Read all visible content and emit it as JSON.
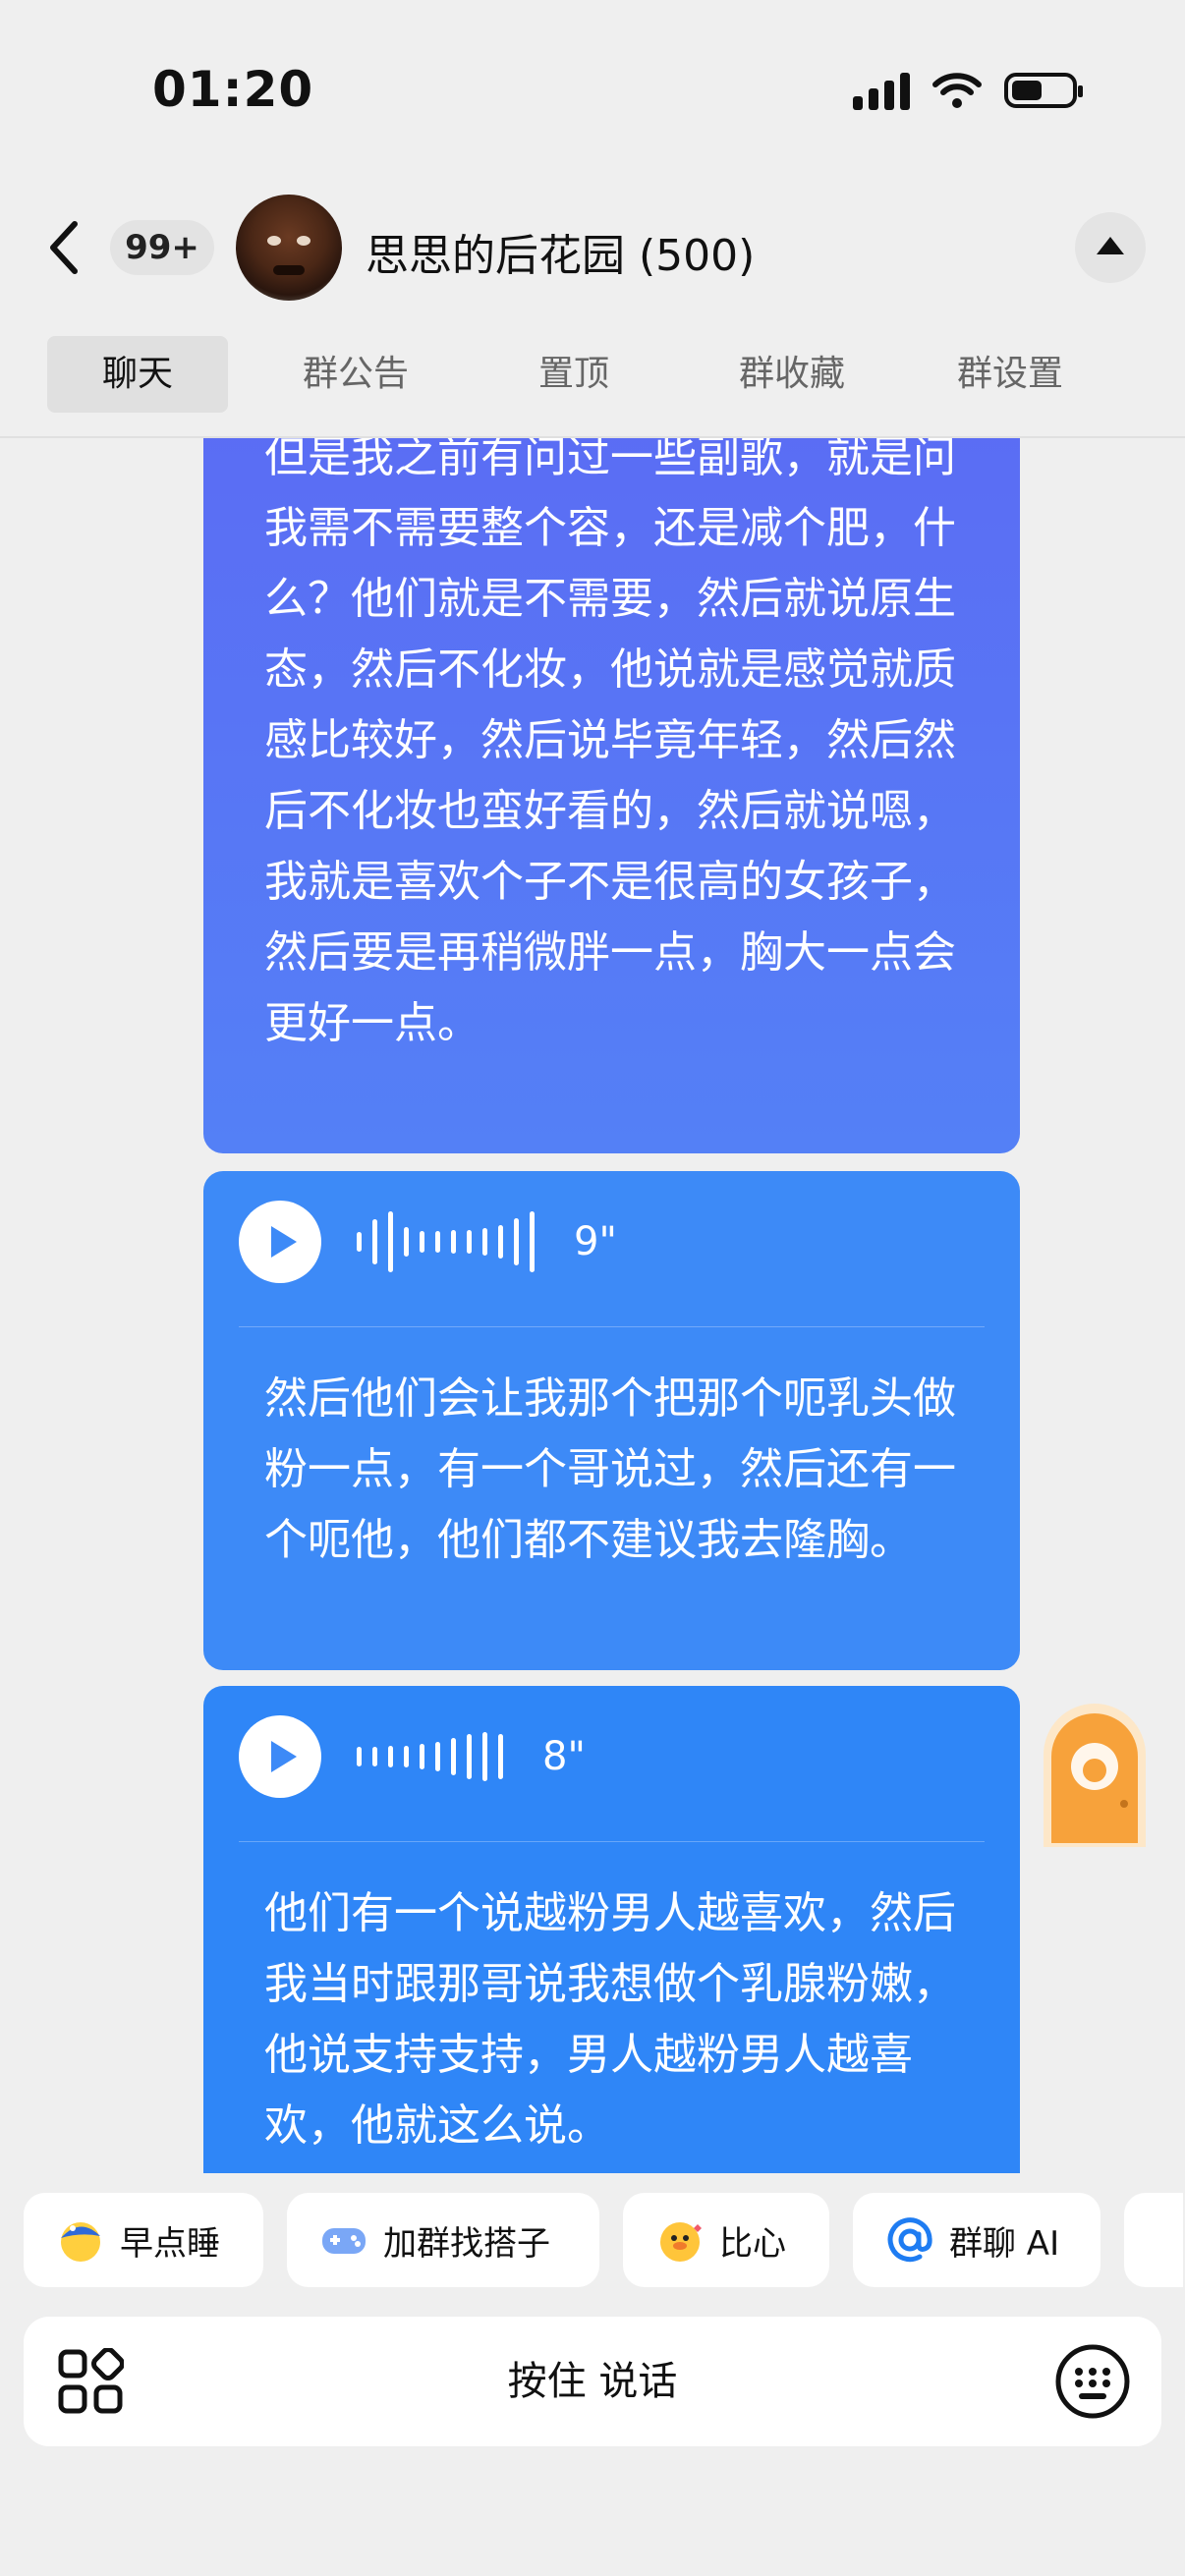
{
  "status_bar": {
    "time": "01:20"
  },
  "header": {
    "unread_count": "99+",
    "group_title": "思思的后花园 (500)"
  },
  "tabs": [
    "聊天",
    "群公告",
    "置顶",
    "群收藏",
    "群设置"
  ],
  "messages": [
    {
      "type": "text",
      "text": "但是我之前有问过一些副歌，就是问我需不需要整个容，还是减个肥，什么？他们就是不需要，然后就说原生态，然后不化妆，他说就是感觉就质感比较好，然后说毕竟年轻，然后然后不化妆也蛮好看的，然后就说嗯，我就是喜欢个子不是很高的女孩子，然后要是再稍微胖一点，胸大一点会更好一点。"
    },
    {
      "type": "voice",
      "duration": "9\"",
      "transcript": "然后他们会让我那个把那个呃乳头做粉一点，有一个哥说过，然后还有一个呃他，他们都不建议我去隆胸。"
    },
    {
      "type": "voice",
      "duration": "8\"",
      "transcript": "他们有一个说越粉男人越喜欢，然后我当时跟那哥说我想做个乳腺粉嫩，他说支持支持，男人越粉男人越喜欢，他就这么说。"
    }
  ],
  "quick_actions": [
    {
      "label": "早点睡",
      "icon": "sleep-planet-icon"
    },
    {
      "label": "加群找搭子",
      "icon": "gamepad-icon"
    },
    {
      "label": "比心",
      "icon": "heart-duck-icon"
    },
    {
      "label": "群聊 AI",
      "icon": "at-sign-icon"
    }
  ],
  "input_bar": {
    "hold_to_talk": "按住 说话"
  },
  "colors": {
    "background": "#efefef",
    "bubble_gradient_top": "#5b6cf4",
    "bubble_voice": "#3d8af7",
    "accent_blue": "#2f86f7",
    "door_orange": "#f7a23b"
  }
}
